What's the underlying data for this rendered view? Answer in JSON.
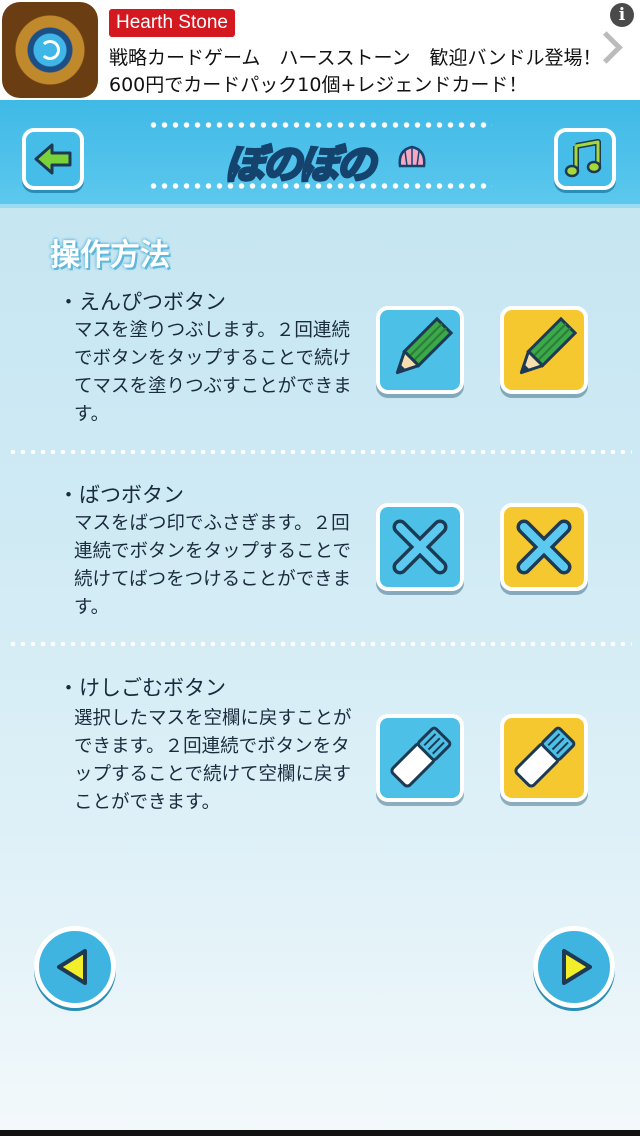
{
  "ad": {
    "badge": "Hearth Stone",
    "line1": "戦略カードゲーム　ハースストーン　歓迎バンドル登場！",
    "line2": "600円でカードパック10個+レジェンドカード！",
    "info": "i"
  },
  "header": {
    "logo": "ぼのぼの"
  },
  "main": {
    "title": "操作方法",
    "items": [
      {
        "title": "・えんぴつボタン",
        "desc": "マスを塗りつぶします。２回連続でボタンをタップすることで続けてマスを塗りつぶすことができます。",
        "icon": "pencil-icon"
      },
      {
        "title": "・ばつボタン",
        "desc": "マスをばつ印でふさぎます。２回連続でボタンをタップすることで続けてばつをつけることができます。",
        "icon": "cross-icon"
      },
      {
        "title": "・けしごむボタン",
        "desc": "選択したマスを空欄に戻すことができます。２回連続でボタンをタップすることで続けて空欄に戻すことができます。",
        "icon": "eraser-icon"
      }
    ]
  },
  "colors": {
    "header": "#3fb9e6",
    "button_blue": "#4cc0e6",
    "button_yellow": "#f6c82f",
    "ad_badge": "#d4181f"
  }
}
